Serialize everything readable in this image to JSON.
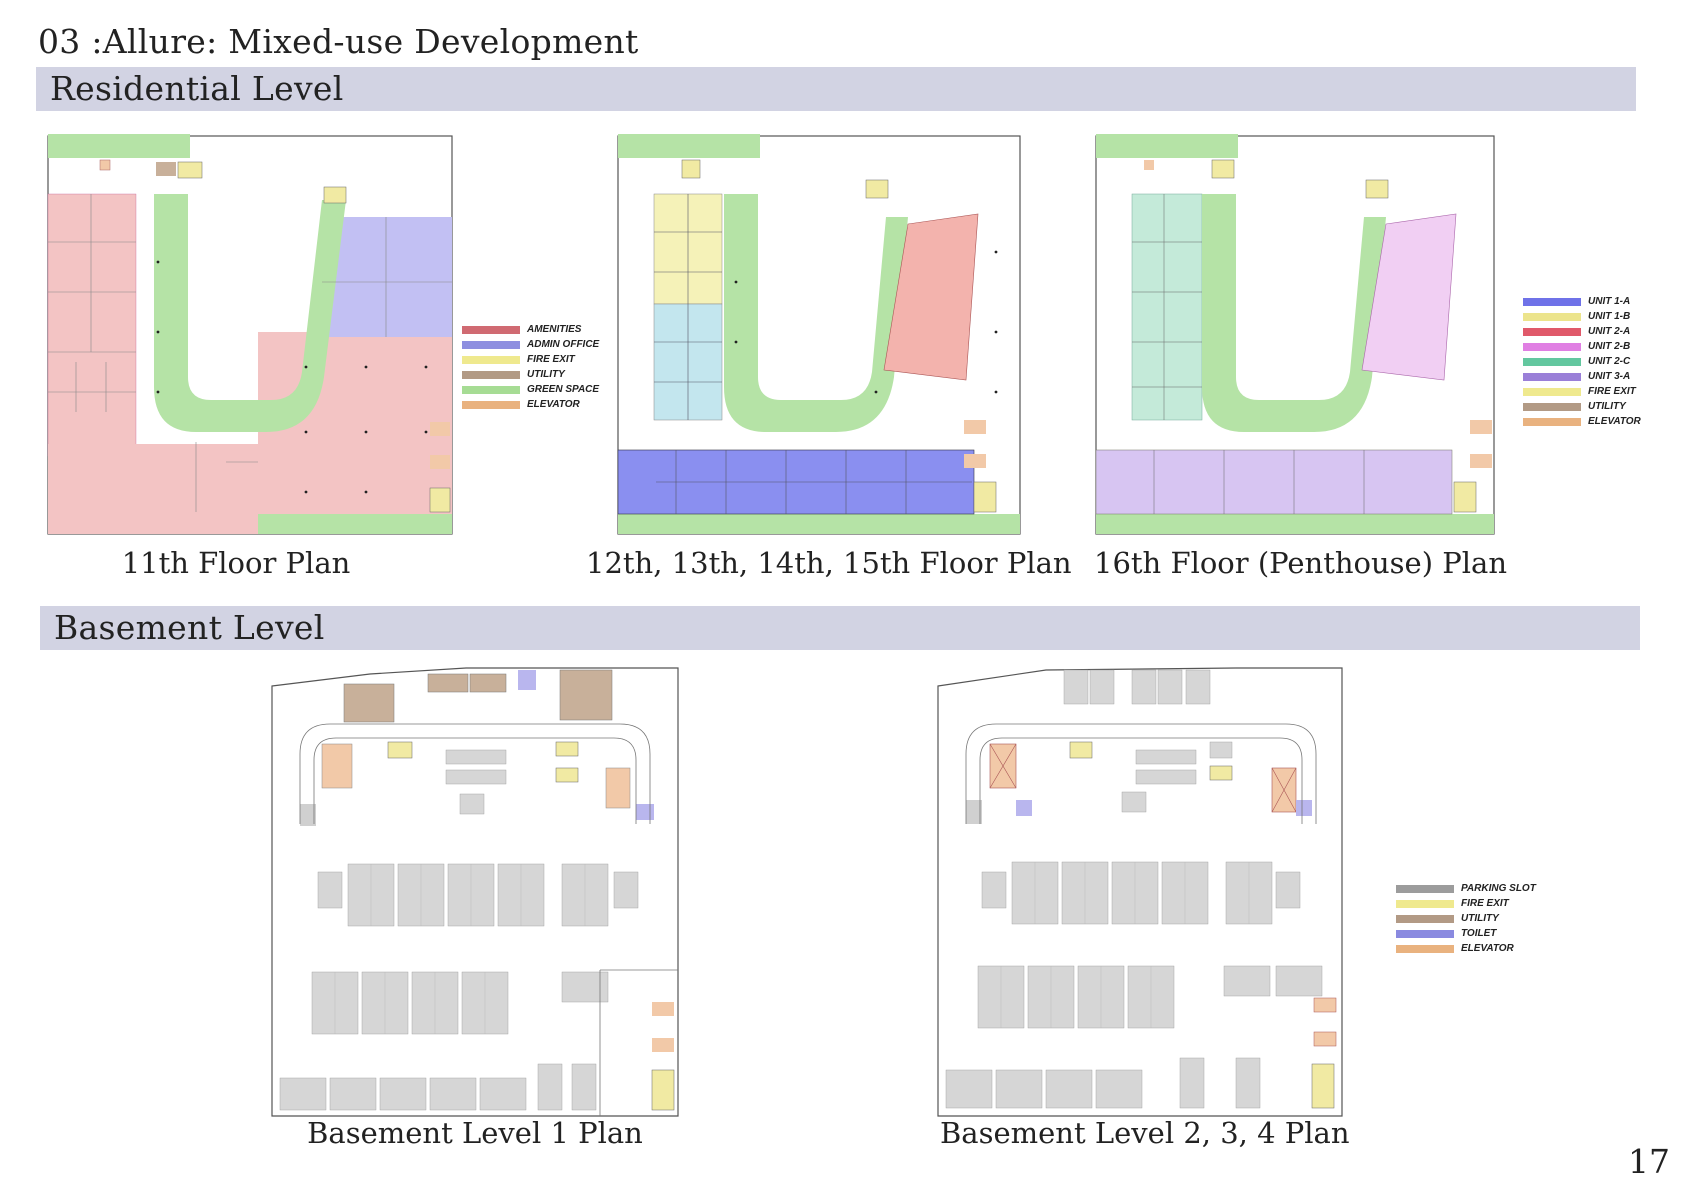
{
  "page": {
    "title": "03 :Allure: Mixed-use Development",
    "page_number": "17"
  },
  "sections": {
    "residential": "Residential Level",
    "basement": "Basement Level"
  },
  "plans": {
    "floor11": "11th Floor Plan",
    "floor12_15": "12th, 13th, 14th, 15th Floor Plan",
    "floor16": "16th Floor (Penthouse) Plan",
    "basement1": "Basement Level 1 Plan",
    "basement2_4": "Basement Level 2, 3, 4 Plan"
  },
  "legends": {
    "residential_use": [
      {
        "label": "AMENITIES",
        "color": "#d06a72"
      },
      {
        "label": "ADMIN OFFICE",
        "color": "#8e8fe0"
      },
      {
        "label": "FIRE EXIT",
        "color": "#efe98e"
      },
      {
        "label": "UTILITY",
        "color": "#b29a85"
      },
      {
        "label": "GREEN SPACE",
        "color": "#a6dc94"
      },
      {
        "label": "ELEVATOR",
        "color": "#e9b27f"
      }
    ],
    "units": [
      {
        "label": "UNIT 1-A",
        "color": "#6f72e8"
      },
      {
        "label": "UNIT 1-B",
        "color": "#ece48c"
      },
      {
        "label": "UNIT 2-A",
        "color": "#e0596a"
      },
      {
        "label": "UNIT 2-B",
        "color": "#e07fe3"
      },
      {
        "label": "UNIT 2-C",
        "color": "#63c79f"
      },
      {
        "label": "UNIT 3-A",
        "color": "#9a7fd8"
      },
      {
        "label": "FIRE EXIT",
        "color": "#efe98e"
      },
      {
        "label": "UTILITY",
        "color": "#b29a85"
      },
      {
        "label": "ELEVATOR",
        "color": "#e9b27f"
      }
    ],
    "basement": [
      {
        "label": "PARKING SLOT",
        "color": "#9c9c9c"
      },
      {
        "label": "FIRE EXIT",
        "color": "#efe98e"
      },
      {
        "label": "UTILITY",
        "color": "#b29a85"
      },
      {
        "label": "TOILET",
        "color": "#8a8ae0"
      },
      {
        "label": "ELEVATOR",
        "color": "#e9b27f"
      }
    ]
  }
}
